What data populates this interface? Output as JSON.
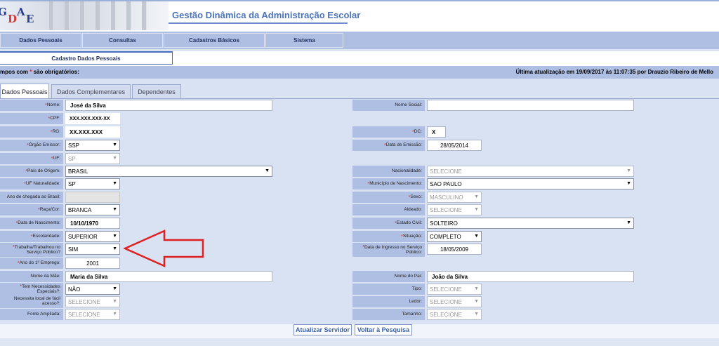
{
  "app": {
    "title": "Gestão Dinâmica da Administração Escolar",
    "logo_text": "GDAE"
  },
  "nav": {
    "items": [
      "Dados Pessoais",
      "Consultas",
      "Cadastros Básicos",
      "Sistema"
    ],
    "sub_tab": "Cadastro Dados Pessoais"
  },
  "info": {
    "required_prefix": "mpos com ",
    "required_star": "*",
    "required_suffix": " são obrigatórios:",
    "last_update": "Última atualização em 19/09/2017 às 11:07:35 por Drauzio Ribeiro de Mello"
  },
  "tabs": [
    "Dados Pessoais",
    "Dados Complementares",
    "Dependentes"
  ],
  "left": {
    "nome": {
      "label": "Nome:",
      "value": "José  da Silva"
    },
    "cpf": {
      "label": "CPF:",
      "value": "XXX.XXX.XXX-XX"
    },
    "rg": {
      "label": "RG:",
      "value": "XX.XXX.XXX"
    },
    "orgao": {
      "label": "Órgão Emissor:",
      "value": "SSP"
    },
    "uf": {
      "label": "UF:",
      "value": "SP"
    },
    "pais": {
      "label": "País de Origem:",
      "value": "BRASIL"
    },
    "uf_nat": {
      "label": "UF Naturalidade:",
      "value": "SP"
    },
    "ano_chegada": {
      "label": "Ano de chegada ao Brasil:",
      "value": ""
    },
    "raca": {
      "label": "Raça/Cor:",
      "value": "BRANCA"
    },
    "nascimento": {
      "label": "Data de Nascimento:",
      "value": "10/10/1970"
    },
    "escolaridade": {
      "label": "Escolaridade:",
      "value": "SUPERIOR"
    },
    "trabalha": {
      "label_line1": "Trabalha/Trabalhou no",
      "label_line2": "Serviço Público?",
      "value": "SIM"
    },
    "ano_emprego": {
      "label": "Ano do 1º Emprego:",
      "value": "2001"
    },
    "mae": {
      "label": "Nome da Mãe:",
      "value": "Maria da Silva"
    },
    "necessidades": {
      "label_line1": "Tem Necessidades",
      "label_line2": "Especiais?:",
      "value": "NÃO"
    },
    "local_acesso": {
      "label_line1": "Necessita local de fácil",
      "label_line2": "acesso?:",
      "value": "SELECIONE"
    },
    "fonte": {
      "label": "Fonte Ampliada:",
      "value": "SELECIONE"
    }
  },
  "right": {
    "nome_social": {
      "label": "Nome Social:",
      "value": ""
    },
    "dc": {
      "label": "DC:",
      "value": "X"
    },
    "data_emissao": {
      "label": "Data de Emissão:",
      "value": "28/05/2014"
    },
    "nacionalidade": {
      "label": "Nacionalidade:",
      "value": "SELECIONE"
    },
    "municipio": {
      "label": "Município de Nascimento:",
      "value": "SAO PAULO"
    },
    "sexo": {
      "label": "Sexo:",
      "value": "MASCULINO"
    },
    "aldeado": {
      "label": "Aldeado:",
      "value": "SELECIONE"
    },
    "estado_civil": {
      "label": "Estado Civil:",
      "value": "SOLTEIRO"
    },
    "situacao": {
      "label": "Situação:",
      "value": "COMPLETO"
    },
    "ingresso": {
      "label_line1": "Data de Ingresso no Serviço",
      "label_line2": "Público:",
      "value": "18/05/2009"
    },
    "pai": {
      "label": "Nome do Pai:",
      "value": "João da Silva"
    },
    "tipo": {
      "label": "Tipo:",
      "value": "SELECIONE"
    },
    "ledor": {
      "label": "Ledor:",
      "value": "SELECIONE"
    },
    "tamanho": {
      "label": "Tamanho:",
      "value": "SELECIONE"
    }
  },
  "buttons": {
    "update": "Atualizar Servidor",
    "back": "Voltar à Pesquisa"
  },
  "colors": {
    "nav": "#aebfe3",
    "form_bg": "#d9e2f3",
    "title": "#4a73b8",
    "required": "#e02020",
    "arrow": "#e02020"
  }
}
